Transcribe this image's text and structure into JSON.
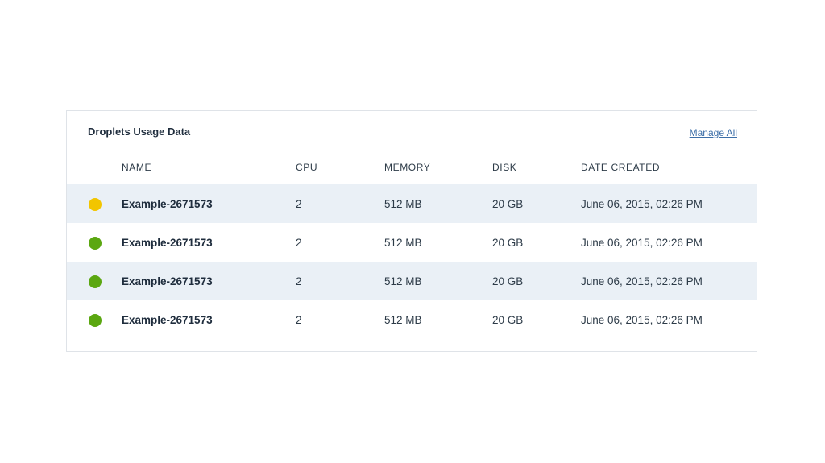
{
  "card": {
    "title": "Droplets Usage Data",
    "manage_label": "Manage All"
  },
  "columns": {
    "name": "NAME",
    "cpu": "CPU",
    "memory": "MEMORY",
    "disk": "DISK",
    "date_created": "DATE CREATED"
  },
  "status_colors": {
    "warning": "#f2c500",
    "active": "#5ba711"
  },
  "rows": [
    {
      "status": "warning",
      "name": "Example-2671573",
      "cpu": "2",
      "memory": "512 MB",
      "disk": "20 GB",
      "date_created": "June 06, 2015, 02:26 PM"
    },
    {
      "status": "active",
      "name": "Example-2671573",
      "cpu": "2",
      "memory": "512 MB",
      "disk": "20 GB",
      "date_created": "June 06, 2015, 02:26 PM"
    },
    {
      "status": "active",
      "name": "Example-2671573",
      "cpu": "2",
      "memory": "512 MB",
      "disk": "20 GB",
      "date_created": "June 06, 2015, 02:26 PM"
    },
    {
      "status": "active",
      "name": "Example-2671573",
      "cpu": "2",
      "memory": "512 MB",
      "disk": "20 GB",
      "date_created": "June 06, 2015, 02:26 PM"
    }
  ]
}
